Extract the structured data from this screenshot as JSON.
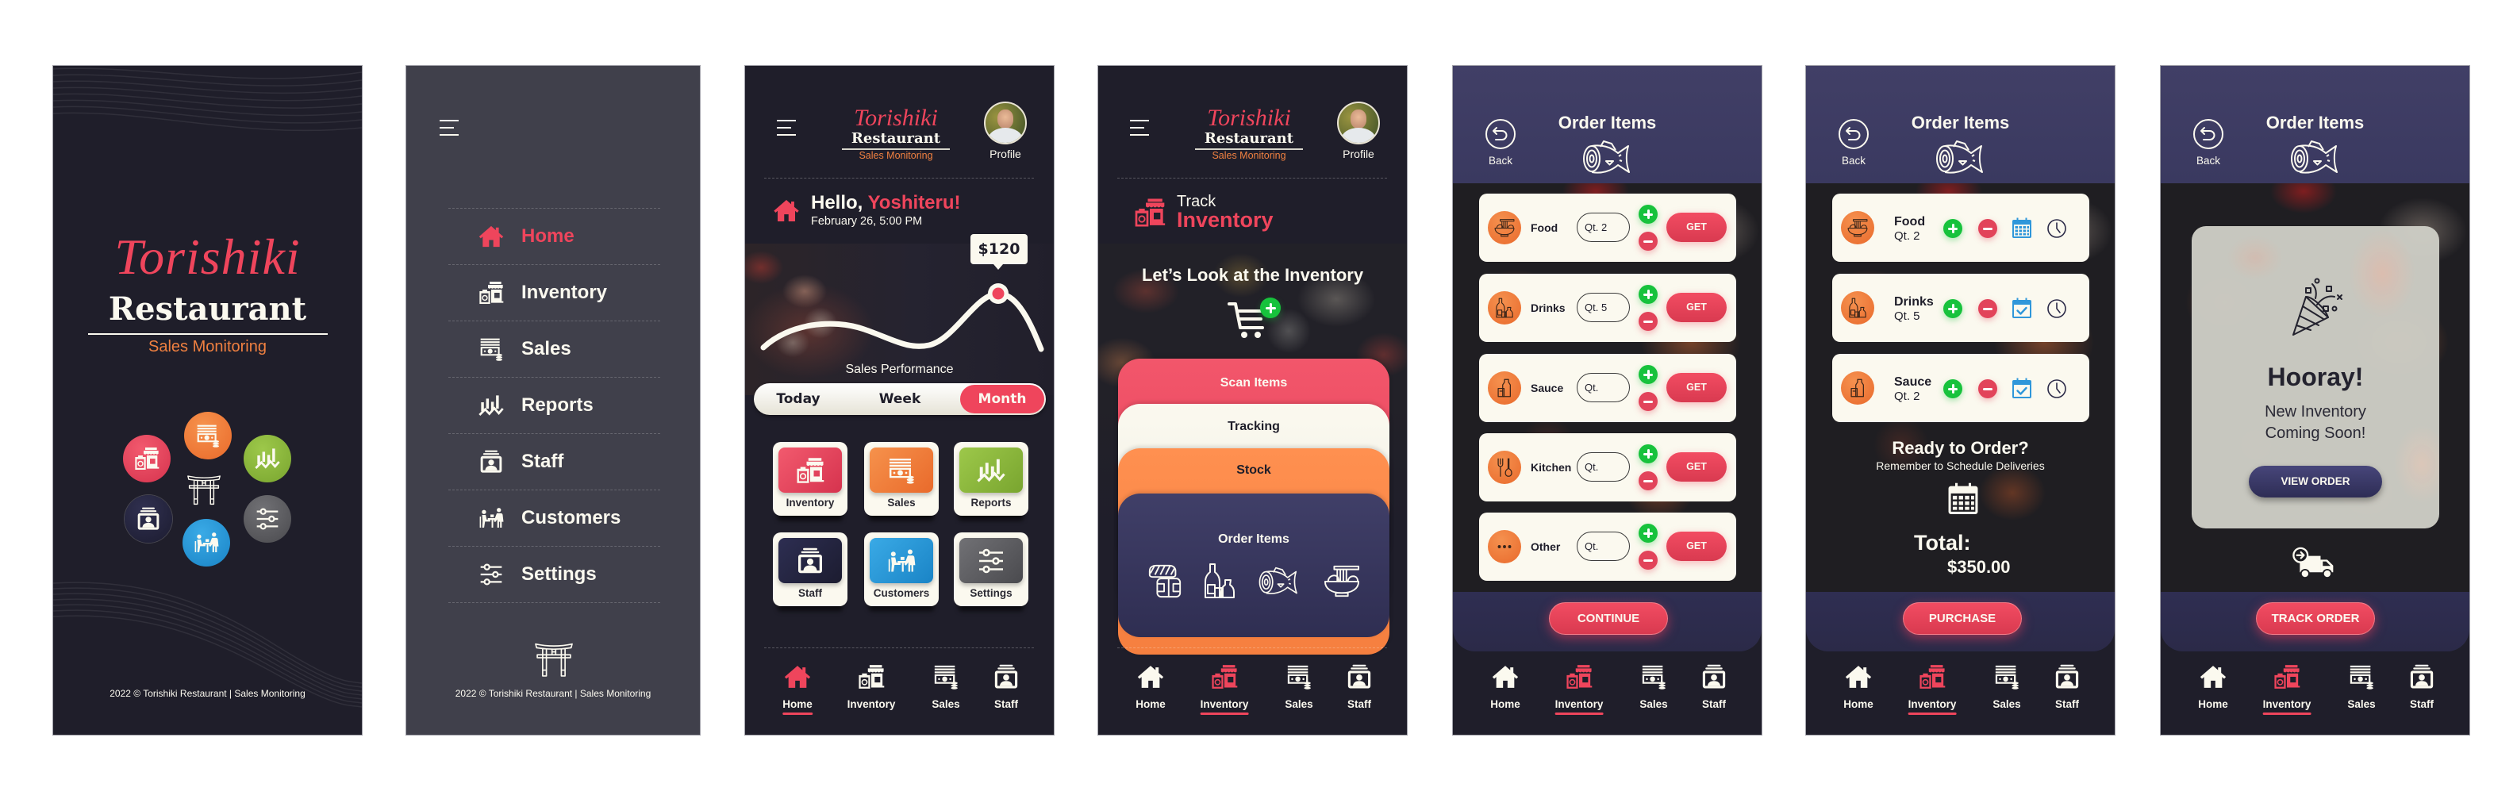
{
  "theme": {
    "accent": "#ef455c",
    "orange": "#f08040",
    "green": "#8cb63c",
    "navy": "#3e3d63",
    "blue": "#2697d9",
    "grey": "#5d5d61",
    "dark_bg": "#1f1e2a",
    "menu_bg": "#40404b",
    "cream": "#fbf9ef",
    "plus_green": "#17c23c",
    "minus_red": "#e2435a"
  },
  "brand": {
    "script": "Torishiki",
    "name": "Restaurant",
    "tagline": "Sales Monitoring",
    "footer": "2022 © Torishiki Restaurant | Sales Monitoring"
  },
  "splash": {
    "feature_icons": [
      "inventory-icon",
      "sales-icon",
      "reports-icon",
      "staff-icon",
      "customers-icon",
      "settings-icon"
    ],
    "center_icon": "torii-gate-icon"
  },
  "menu": {
    "active": "Home",
    "items": [
      {
        "label": "Home",
        "icon": "home-icon"
      },
      {
        "label": "Inventory",
        "icon": "inventory-icon"
      },
      {
        "label": "Sales",
        "icon": "sales-icon"
      },
      {
        "label": "Reports",
        "icon": "reports-icon"
      },
      {
        "label": "Staff",
        "icon": "staff-icon"
      },
      {
        "label": "Customers",
        "icon": "customers-icon"
      },
      {
        "label": "Settings",
        "icon": "settings-icon"
      }
    ]
  },
  "header": {
    "profile_label": "Profile"
  },
  "home": {
    "greeting": "Hello,",
    "user_name": "Yoshiteru!",
    "datetime": "February 26, 5:00 PM",
    "chart_label": "Sales Performance",
    "highlight_value": "$120",
    "ranges": [
      "Today",
      "Week",
      "Month"
    ],
    "selected_range": "Month",
    "tiles": [
      {
        "label": "Inventory",
        "icon": "inventory-icon"
      },
      {
        "label": "Sales",
        "icon": "sales-icon"
      },
      {
        "label": "Reports",
        "icon": "reports-icon"
      },
      {
        "label": "Staff",
        "icon": "staff-icon"
      },
      {
        "label": "Customers",
        "icon": "customers-icon"
      },
      {
        "label": "Settings",
        "icon": "settings-icon"
      }
    ]
  },
  "bottom_nav": {
    "items": [
      {
        "label": "Home",
        "icon": "home-icon"
      },
      {
        "label": "Inventory",
        "icon": "inventory-icon"
      },
      {
        "label": "Sales",
        "icon": "sales-icon"
      },
      {
        "label": "Staff",
        "icon": "staff-icon"
      }
    ]
  },
  "track": {
    "title_small": "Track",
    "title_big": "Inventory",
    "prompt": "Let’s Look at the Inventory",
    "sections": [
      "Scan Items",
      "Tracking",
      "Stock",
      "Order Items"
    ],
    "order_icons": [
      "sushi-icon",
      "sake-icon",
      "fish-icon",
      "ramen-icon"
    ]
  },
  "order": {
    "back_label": "Back",
    "title": "Order Items",
    "get_label": "GET",
    "continue_label": "CONTINUE",
    "qty_placeholder": "Qt.",
    "items": [
      {
        "name": "Food",
        "icon": "ramen-icon",
        "qty": "Qt. 2"
      },
      {
        "name": "Drinks",
        "icon": "sake-icon",
        "qty": "Qt. 5"
      },
      {
        "name": "Sauce",
        "icon": "sauce-icon",
        "qty": ""
      },
      {
        "name": "Kitchen",
        "icon": "utensils-icon",
        "qty": ""
      },
      {
        "name": "Other",
        "icon": "more-icon",
        "qty": ""
      }
    ]
  },
  "summary": {
    "items": [
      {
        "name": "Food",
        "qty": "Qt. 2",
        "delivery_scheduled": false
      },
      {
        "name": "Drinks",
        "qty": "Qt. 5",
        "delivery_scheduled": true
      },
      {
        "name": "Sauce",
        "qty": "Qt. 2",
        "delivery_scheduled": true
      }
    ],
    "ready_title": "Ready to Order?",
    "ready_subtitle": "Remember to Schedule Deliveries",
    "total_label": "Total:",
    "total_value": "$350.00",
    "purchase_label": "PURCHASE"
  },
  "confirmation": {
    "title": "Hooray!",
    "message_line1": "New Inventory",
    "message_line2": "Coming Soon!",
    "view_order_label": "VIEW ORDER",
    "track_order_label": "TRACK ORDER"
  }
}
